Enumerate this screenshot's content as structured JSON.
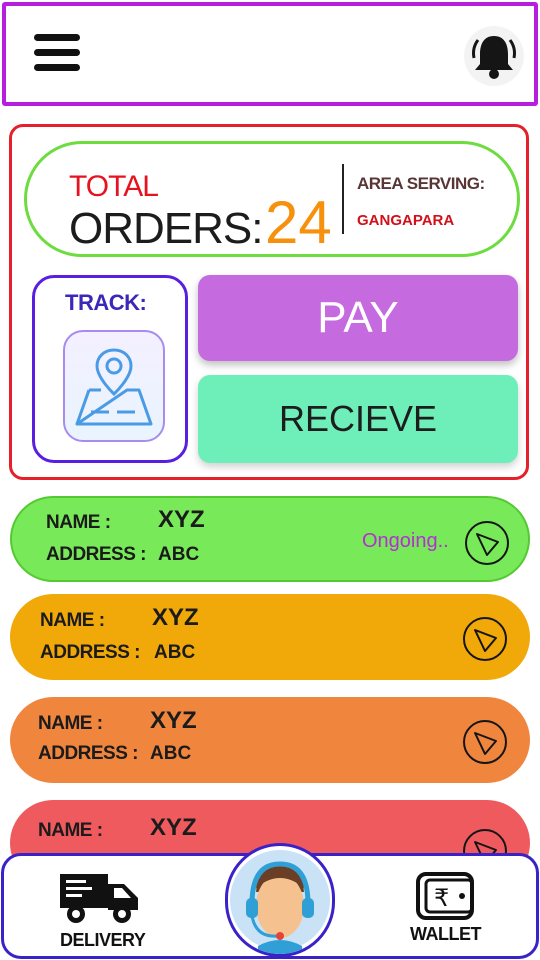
{
  "header": {
    "menu_icon": "hamburger-menu-icon",
    "notification_icon": "bell-icon"
  },
  "summary": {
    "total_label": "TOTAL",
    "orders_label": "ORDERS:",
    "orders_count": "24",
    "area_label": "AREA SERVING:",
    "area_value": "GANGAPARA",
    "track_label": "TRACK:",
    "track_icon": "map-location-icon",
    "pay_label": "PAY",
    "receive_label": "RECIEVE"
  },
  "orders": [
    {
      "name_label": "NAME :",
      "name": "XYZ",
      "address_label": "ADDRESS :",
      "address": "ABC",
      "status": "Ongoing..",
      "color": "#78ea5a"
    },
    {
      "name_label": "NAME :",
      "name": "XYZ",
      "address_label": "ADDRESS :",
      "address": "ABC",
      "status": "",
      "color": "#f1a90a"
    },
    {
      "name_label": "NAME :",
      "name": "XYZ",
      "address_label": "ADDRESS :",
      "address": "ABC",
      "status": "",
      "color": "#f0853e"
    },
    {
      "name_label": "NAME :",
      "name": "XYZ",
      "status": "",
      "color": "#ef5a5e"
    }
  ],
  "bottom_nav": {
    "delivery_label": "DELIVERY",
    "delivery_icon": "delivery-truck-icon",
    "support_icon": "support-agent-icon",
    "wallet_label": "WALLET",
    "wallet_icon": "wallet-rupee-icon"
  },
  "colors": {
    "header_border": "#b41fe0",
    "summary_border": "#e5202a",
    "pay": "#c66ae0",
    "receive": "#6eeeb8",
    "bottom_border": "#3a22c9"
  }
}
